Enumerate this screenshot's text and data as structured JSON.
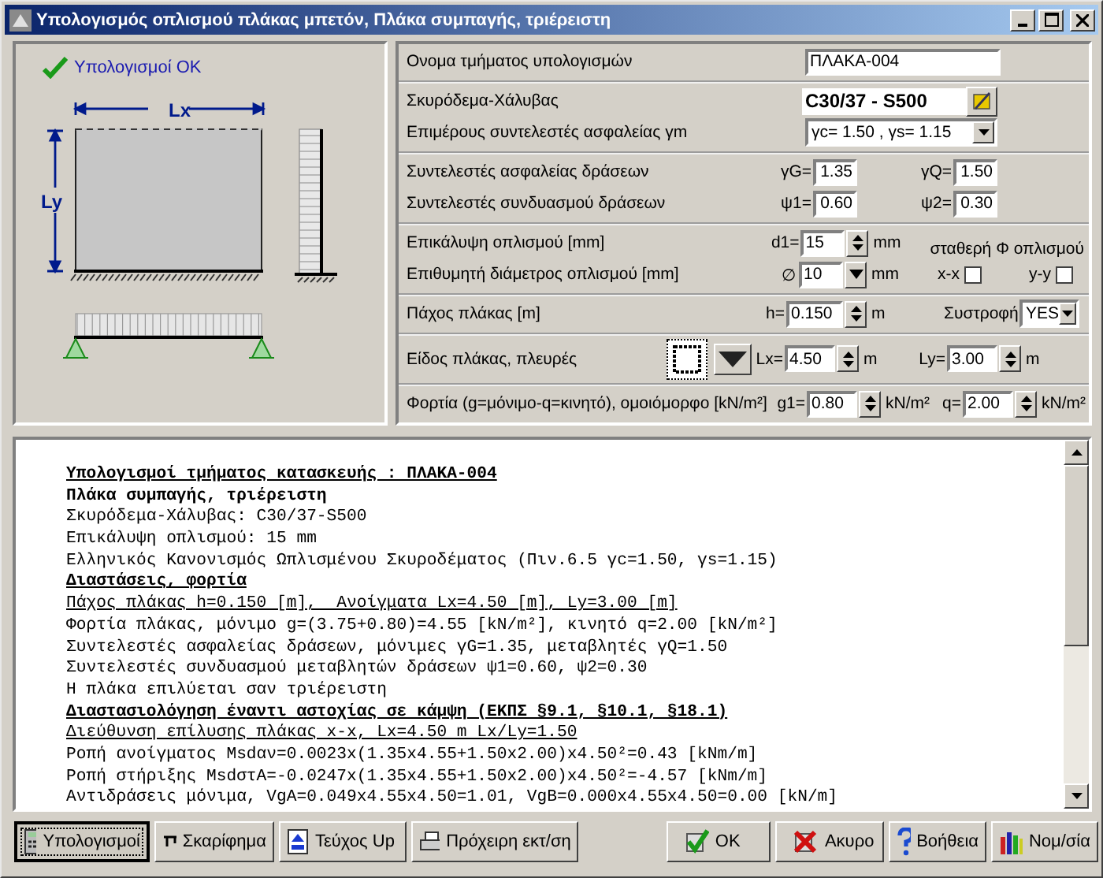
{
  "window": {
    "title": "Υπολογισμός οπλισμού πλάκας μπετόν, Πλάκα συμπαγής, τριέρειστη"
  },
  "status": {
    "text": "Υπολογισμοί ΟΚ"
  },
  "diagram": {
    "lx_label": "Lx",
    "ly_label": "Ly"
  },
  "form": {
    "name": {
      "label": "Ονομα τμήματος υπολογισμών",
      "value": "ΠΛΑΚΑ-004"
    },
    "material": {
      "label": "Σκυρόδεμα-Χάλυβας",
      "value": "C30/37 - S500"
    },
    "partial_factors": {
      "label": "Επιμέρους συντελεστές ασφαλείας γm",
      "value": "γc= 1.50 , γs= 1.15"
    },
    "action_factors": {
      "label": "Συντελεστές ασφαλείας δράσεων",
      "fields": [
        {
          "prefix": "γG=",
          "value": "1.35"
        },
        {
          "prefix": "γQ=",
          "value": "1.50"
        }
      ]
    },
    "combination_factors": {
      "label": "Συντελεστές συνδυασμού δράσεων",
      "fields": [
        {
          "prefix": "ψ1=",
          "value": "0.60"
        },
        {
          "prefix": "ψ2=",
          "value": "0.30"
        }
      ]
    },
    "cover": {
      "label": "Επικάλυψη οπλισμού [mm]",
      "prefix": "d1=",
      "value": "15",
      "unit": "mm"
    },
    "constant_header": "σταθερή Φ οπλισμού",
    "diameter": {
      "label": "Επιθυμητή διάμετρος οπλισμού [mm]",
      "prefix": "∅",
      "value": "10",
      "unit": "mm"
    },
    "constant_checks": [
      {
        "label": "x-x",
        "checked": false
      },
      {
        "label": "y-y",
        "checked": false
      }
    ],
    "thickness": {
      "label": "Πάχος πλάκας [m]",
      "prefix": "h=",
      "value": "0.150",
      "unit": "m"
    },
    "torsion": {
      "label": "Συστροφή",
      "value": "YES"
    },
    "slab_type": {
      "label": "Είδος πλάκας, πλευρές",
      "fields": [
        {
          "prefix": "Lx=",
          "value": "4.50",
          "unit": "m"
        },
        {
          "prefix": "Ly=",
          "value": "3.00",
          "unit": "m"
        }
      ]
    },
    "loads": {
      "label": "Φορτία (g=μόνιμο-q=κινητό), ομοιόμορφο [kN/m²]",
      "fields": [
        {
          "prefix": "g1=",
          "value": "0.80",
          "unit": "kN/m²"
        },
        {
          "prefix": "q=",
          "value": "2.00",
          "unit": "kN/m²"
        }
      ]
    }
  },
  "report": {
    "lines": [
      {
        "kind": "heading",
        "text": "Υπολογισμοί τμήματος κατασκευής : ΠΛΑΚΑ-004"
      },
      {
        "kind": "bold",
        "text": "Πλάκα συμπαγής, τριέρειστη"
      },
      {
        "kind": "plain",
        "text": "Σκυρόδεμα-Χάλυβας: C30/37-S500"
      },
      {
        "kind": "plain",
        "text": "Επικάλυψη οπλισμού: 15 mm"
      },
      {
        "kind": "plain",
        "text": "Ελληνικός Κανονισμός Ωπλισμένου Σκυροδέματος (Πιν.6.5 γc=1.50, γs=1.15)"
      },
      {
        "kind": "heading",
        "text": "Διαστάσεις, φορτία"
      },
      {
        "kind": "underlined",
        "text": "Πάχος πλάκας h=0.150 [m],  Ανοίγματα Lx=4.50 [m], Ly=3.00 [m]"
      },
      {
        "kind": "plain",
        "text": "Φορτία πλάκας, μόνιμο g=(3.75+0.80)=4.55 [kN/m²], κινητό q=2.00 [kN/m²]"
      },
      {
        "kind": "plain",
        "text": "Συντελεστές ασφαλείας δράσεων, μόνιμες γG=1.35, μεταβλητές γQ=1.50"
      },
      {
        "kind": "plain",
        "text": "Συντελεστές συνδυασμού μεταβλητών δράσεων ψ1=0.60, ψ2=0.30"
      },
      {
        "kind": "plain",
        "text": "Η πλάκα επιλύεται σαν τριέρειστη"
      },
      {
        "kind": "heading",
        "text": "Διαστασιολόγηση έναντι αστοχίας σε κάμψη (ΕΚΠΣ §9.1, §10.1, §18.1)"
      },
      {
        "kind": "underlined",
        "text": "Διεύθυνση επίλυσης πλάκας x-x, Lx=4.50 m Lx/Ly=1.50"
      },
      {
        "kind": "plain",
        "text": "Ροπή ανοίγματος Msdαν=0.0023x(1.35x4.55+1.50x2.00)x4.50²=0.43 [kNm/m]"
      },
      {
        "kind": "plain",
        "text": "Ροπή στήριξης MsdστA=-0.0247x(1.35x4.55+1.50x2.00)x4.50²=-4.57 [kNm/m]"
      },
      {
        "kind": "plain",
        "text": "Αντιδράσεις μόνιμα, VgA=0.049x4.55x4.50=1.01, VgB=0.000x4.55x4.50=0.00 [kN/m]"
      }
    ]
  },
  "buttons": [
    {
      "label": "Υπολογισμοί",
      "selected": true
    },
    {
      "label": "Σκαρίφημα",
      "selected": false
    },
    {
      "label": "Τεύχος Up",
      "selected": false
    },
    {
      "label": "Πρόχειρη εκτ/ση",
      "selected": false
    },
    {
      "label": "OK",
      "selected": false
    },
    {
      "label": "Ακυρο",
      "selected": false
    },
    {
      "label": "Βοήθεια",
      "selected": false
    },
    {
      "label": "Νομ/σία",
      "selected": false
    }
  ]
}
